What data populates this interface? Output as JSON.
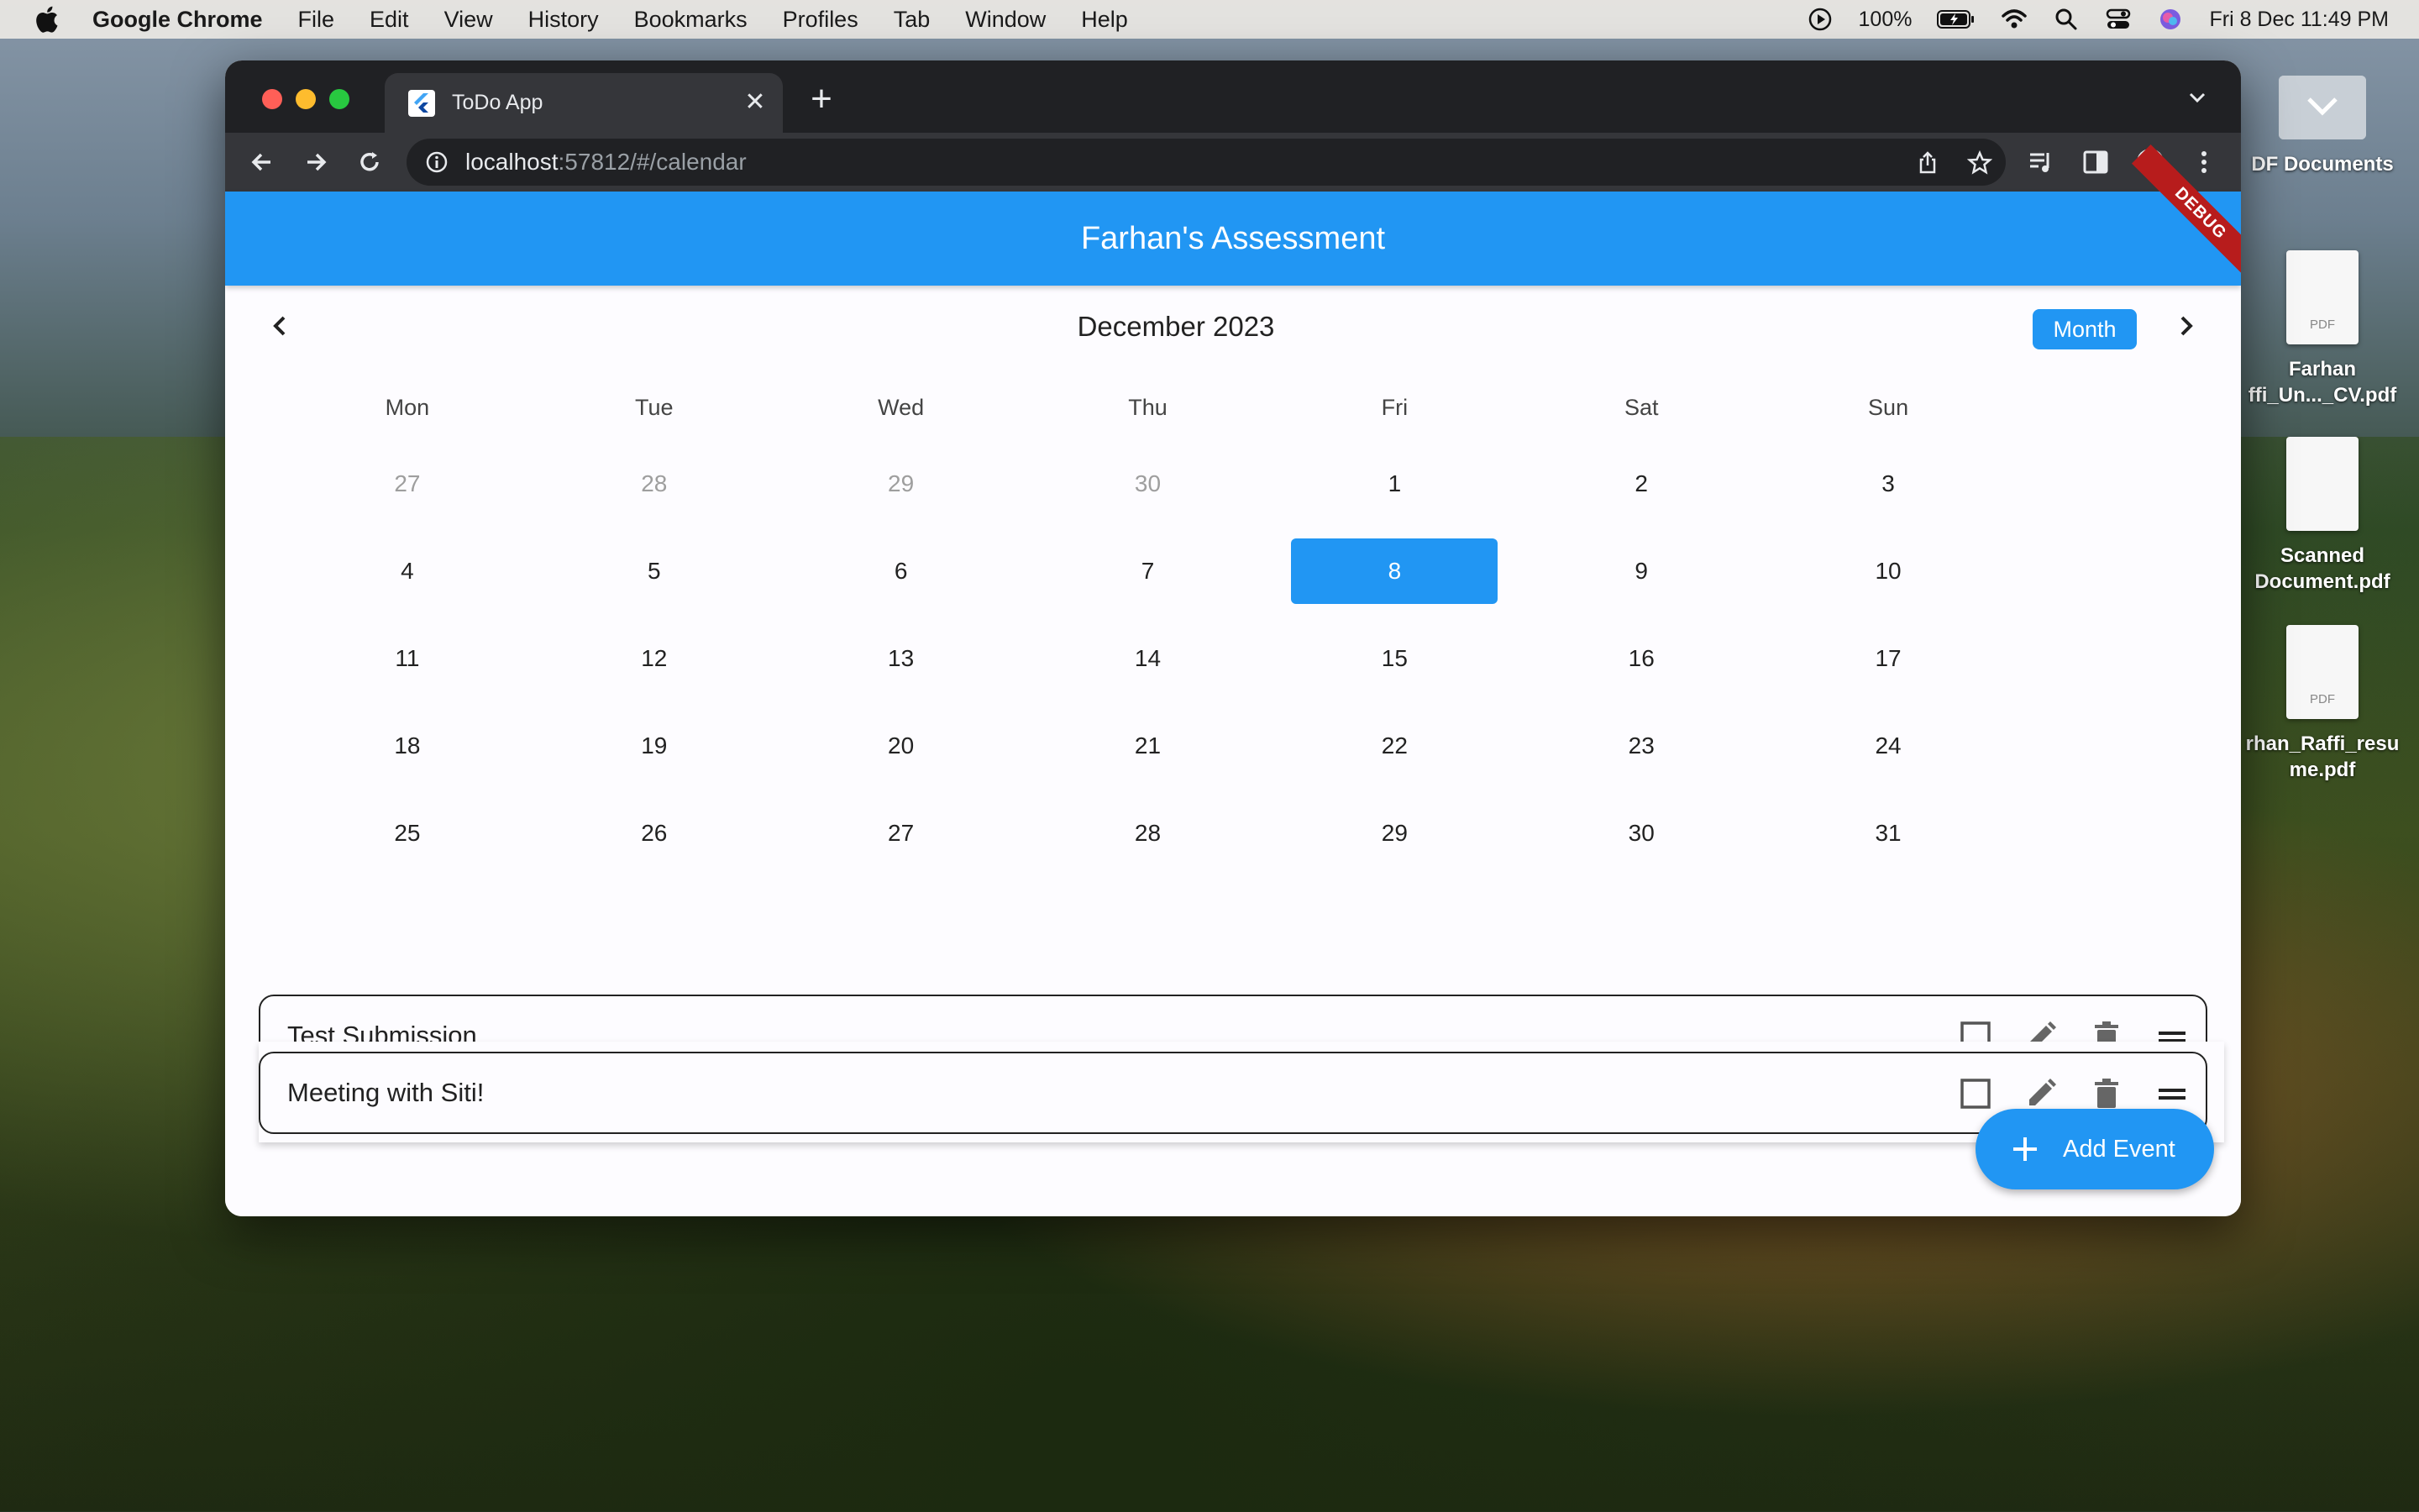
{
  "menubar": {
    "app_name": "Google Chrome",
    "items": [
      "File",
      "Edit",
      "View",
      "History",
      "Bookmarks",
      "Profiles",
      "Tab",
      "Window",
      "Help"
    ],
    "battery": "100%",
    "datetime": "Fri 8 Dec  11:49 PM"
  },
  "desktop": {
    "items": [
      {
        "label": "DF Documents"
      },
      {
        "label": "Farhan ffi_Un..._CV.pdf",
        "tag": "PDF"
      },
      {
        "label": "Scanned Document.pdf"
      },
      {
        "label": "rhan_Raffi_resu me.pdf",
        "tag": "PDF"
      }
    ]
  },
  "browser": {
    "tab_title": "ToDo App",
    "url_host": "localhost",
    "url_rest": ":57812/#/calendar"
  },
  "app": {
    "title": "Farhan's Assessment",
    "debug_label": "DEBUG",
    "calendar": {
      "title": "December 2023",
      "view_button": "Month",
      "weekdays": [
        "Mon",
        "Tue",
        "Wed",
        "Thu",
        "Fri",
        "Sat",
        "Sun"
      ],
      "weeks": [
        [
          "27",
          "28",
          "29",
          "30",
          "1",
          "2",
          "3"
        ],
        [
          "4",
          "5",
          "6",
          "7",
          "8",
          "9",
          "10"
        ],
        [
          "11",
          "12",
          "13",
          "14",
          "15",
          "16",
          "17"
        ],
        [
          "18",
          "19",
          "20",
          "21",
          "22",
          "23",
          "24"
        ],
        [
          "25",
          "26",
          "27",
          "28",
          "29",
          "30",
          "31"
        ]
      ],
      "selected_day": "8"
    },
    "events": [
      {
        "title": "Test Submission"
      },
      {
        "title": "Meeting with Siti!"
      }
    ],
    "fab_label": "Add Event"
  },
  "colors": {
    "primary": "#2196f3",
    "debug": "#b71c1c"
  }
}
